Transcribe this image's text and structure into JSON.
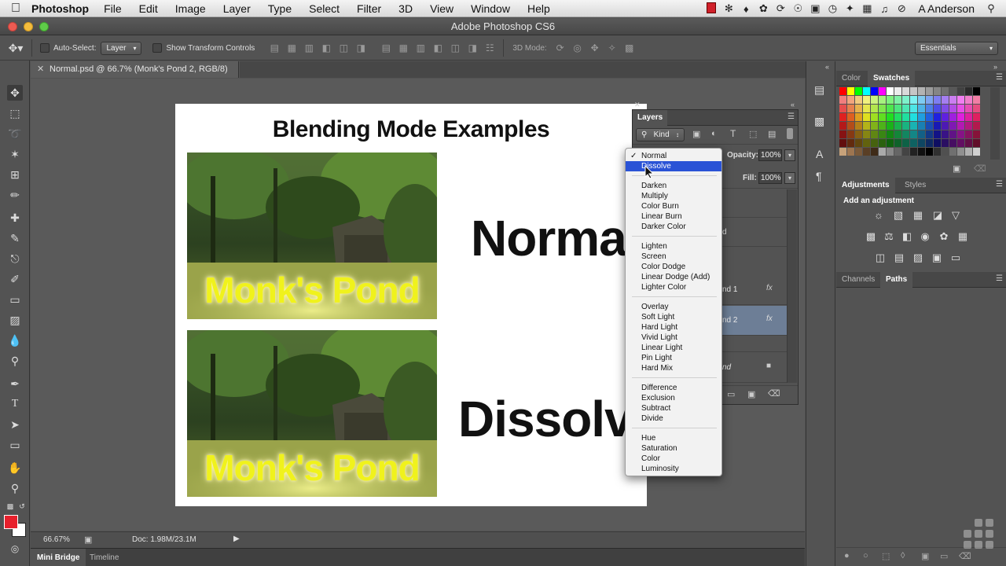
{
  "menubar": {
    "app": "Photoshop",
    "items": [
      "File",
      "Edit",
      "Image",
      "Layer",
      "Type",
      "Select",
      "Filter",
      "3D",
      "View",
      "Window",
      "Help"
    ],
    "user": "A Anderson"
  },
  "window": {
    "title": "Adobe Photoshop CS6"
  },
  "options_bar": {
    "auto_select_label": "Auto-Select:",
    "auto_select_value": "Layer",
    "show_transform_label": "Show Transform Controls",
    "mode_3d_label": "3D Mode:",
    "workspace": "Essentials"
  },
  "document": {
    "tab_title": "Normal.psd @ 66.7% (Monk's Pond 2, RGB/8)",
    "heading": "Blending Mode Examples",
    "photo_caption": "Monk's Pond",
    "label_top": "Normal",
    "label_bottom": "Dissolve"
  },
  "status": {
    "zoom": "66.67%",
    "doc_size": "Doc: 1.98M/23.1M"
  },
  "bottom_tabs": [
    "Mini Bridge",
    "Timeline"
  ],
  "layers_panel": {
    "title": "Layers",
    "filter_kind": "Kind",
    "opacity_label": "Opacity:",
    "opacity_value": "100%",
    "fill_label": "Fill:",
    "fill_value": "100%",
    "row_partials": [
      "d",
      "nd 1",
      "nd 2",
      "nd"
    ],
    "fx_label": "fx"
  },
  "blend_menu": {
    "checked": "Normal",
    "selected": "Dissolve",
    "groups": [
      [
        "Normal",
        "Dissolve"
      ],
      [
        "Darken",
        "Multiply",
        "Color Burn",
        "Linear Burn",
        "Darker Color"
      ],
      [
        "Lighten",
        "Screen",
        "Color Dodge",
        "Linear Dodge (Add)",
        "Lighter Color"
      ],
      [
        "Overlay",
        "Soft Light",
        "Hard Light",
        "Vivid Light",
        "Linear Light",
        "Pin Light",
        "Hard Mix"
      ],
      [
        "Difference",
        "Exclusion",
        "Subtract",
        "Divide"
      ],
      [
        "Hue",
        "Saturation",
        "Color",
        "Luminosity"
      ]
    ]
  },
  "right_panels": {
    "color_tabs": [
      "Color",
      "Swatches"
    ],
    "adjust_tabs": [
      "Adjustments",
      "Styles"
    ],
    "adjust_hint": "Add an adjustment",
    "path_tabs": [
      "Channels",
      "Paths"
    ]
  },
  "colors": {
    "foreground": "#e8202c",
    "background": "#ffffff",
    "menu_highlight": "#2a53d6"
  }
}
